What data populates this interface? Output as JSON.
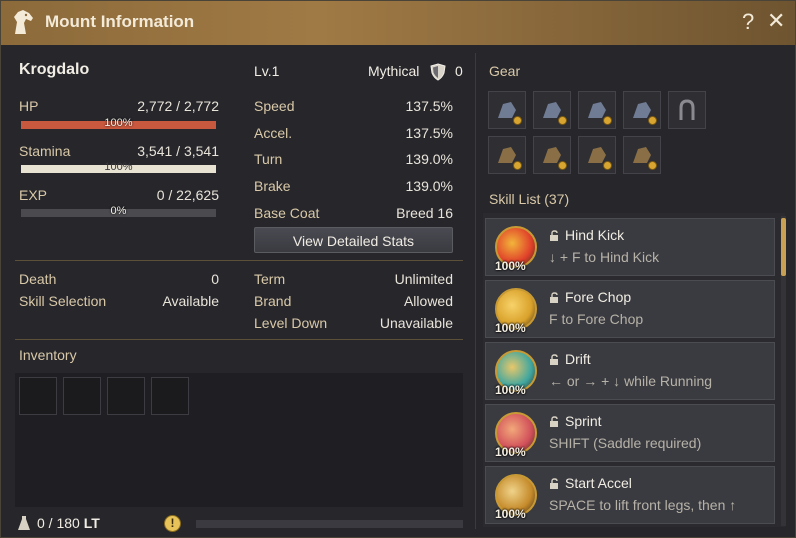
{
  "window": {
    "title": "Mount Information",
    "help_label": "?",
    "close_label": "✕"
  },
  "mount": {
    "name": "Krogdalo",
    "level": "Lv.1",
    "grade": "Mythical",
    "shield_count": "0",
    "hp": {
      "label": "HP",
      "current": "2,772",
      "max": "2,772",
      "sep": "/",
      "percent_text": "100%",
      "ratio": 1.0,
      "color": "#c8583e"
    },
    "stamina": {
      "label": "Stamina",
      "current": "3,541",
      "max": "3,541",
      "sep": "/",
      "percent_text": "100%",
      "ratio": 1.0,
      "color": "#e8e2d2"
    },
    "exp": {
      "label": "EXP",
      "current": "0",
      "max": "22,625",
      "sep": "/",
      "percent_text": "0%",
      "ratio": 0.0,
      "color": "#8a8a8f"
    }
  },
  "stats": [
    {
      "label": "Speed",
      "value": "137.5%"
    },
    {
      "label": "Accel.",
      "value": "137.5%"
    },
    {
      "label": "Turn",
      "value": "139.0%"
    },
    {
      "label": "Brake",
      "value": "139.0%"
    },
    {
      "label": "Base Coat",
      "value": "Breed 16"
    }
  ],
  "view_stats_button": "View Detailed Stats",
  "details_left": [
    {
      "label": "Death",
      "value": "0"
    },
    {
      "label": "Skill Selection",
      "value": "Available"
    }
  ],
  "details_right": [
    {
      "label": "Term",
      "value": "Unlimited"
    },
    {
      "label": "Brand",
      "value": "Allowed"
    },
    {
      "label": "Level Down",
      "value": "Unavailable"
    }
  ],
  "inventory": {
    "title": "Inventory",
    "weight": "0 / 180",
    "weight_unit": "LT",
    "warning_icon": "!"
  },
  "gear": {
    "title": "Gear",
    "slots": [
      "champron-icon",
      "saddle-icon",
      "stirrups-icon",
      "barding-icon",
      "horseshoe-icon",
      "champron-icon",
      "saddle-icon",
      "stirrups-icon",
      "barding-icon"
    ]
  },
  "skill_list": {
    "title": "Skill List (37)",
    "skills": [
      {
        "name": "Hind Kick",
        "desc": "↓ + F to Hind Kick",
        "percent": "100%",
        "colors": [
          "#e0402a",
          "#f2b53a"
        ]
      },
      {
        "name": "Fore Chop",
        "desc": "F to Fore Chop",
        "percent": "100%",
        "colors": [
          "#d9a12a",
          "#f7d26a"
        ]
      },
      {
        "name": "Drift",
        "desc": "← or → + ↓ while Running",
        "percent": "100%",
        "colors": [
          "#3ea6a0",
          "#e8c76a"
        ]
      },
      {
        "name": "Sprint",
        "desc": "SHIFT (Saddle required)",
        "percent": "100%",
        "colors": [
          "#d1505a",
          "#f2a87a"
        ]
      },
      {
        "name": "Start Accel",
        "desc": "SPACE to lift front legs, then ↑",
        "percent": "100%",
        "colors": [
          "#c58a2a",
          "#efd38a"
        ]
      }
    ]
  }
}
